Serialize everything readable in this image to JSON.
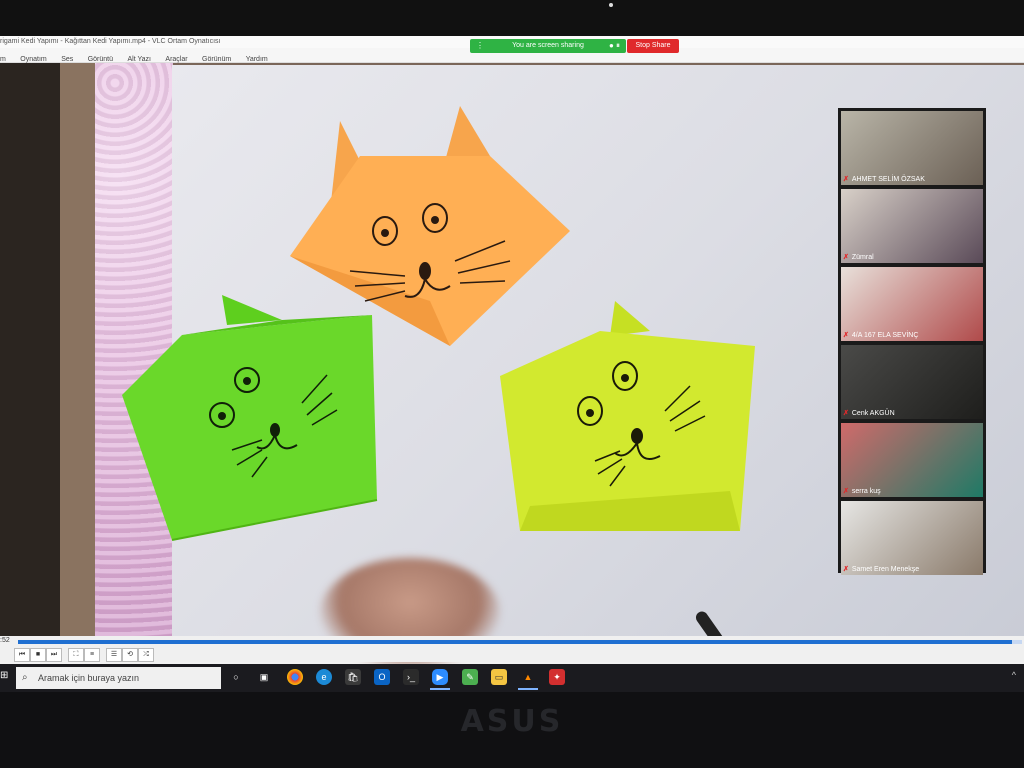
{
  "window": {
    "title": "rigami Kedi Yapımı - Kağıttan Kedi Yapımı.mp4 - VLC Ortam Oynatıcısı"
  },
  "menu": [
    "m",
    "Oynatım",
    "Ses",
    "Görüntü",
    "Alt Yazı",
    "Araçlar",
    "Görünüm",
    "Yardım"
  ],
  "screen_share": {
    "status": "You are screen sharing",
    "stop_label": "Stop Share",
    "status_color": "#2fb344",
    "stop_color": "#e0292b"
  },
  "participants": [
    {
      "name": "AHMET SELİM ÖZSAK"
    },
    {
      "name": "Zümral"
    },
    {
      "name": "4/A 167 ELA SEVİNÇ"
    },
    {
      "name": "Cenk    AKGÜN"
    },
    {
      "name": "serra kuş"
    },
    {
      "name": "Samet Eren Menekşe"
    }
  ],
  "player": {
    "time": ":52",
    "progress": 0.99
  },
  "taskbar": {
    "search_placeholder": "Aramak için buraya yazın",
    "apps": [
      "task-view-icon",
      "chrome-icon",
      "edge-icon",
      "store-icon",
      "outlook-icon",
      "terminal-icon",
      "zoom-icon",
      "paint-icon",
      "file-explorer-icon",
      "vlc-icon",
      "pdf-icon"
    ]
  },
  "device_brand": "ASUS"
}
